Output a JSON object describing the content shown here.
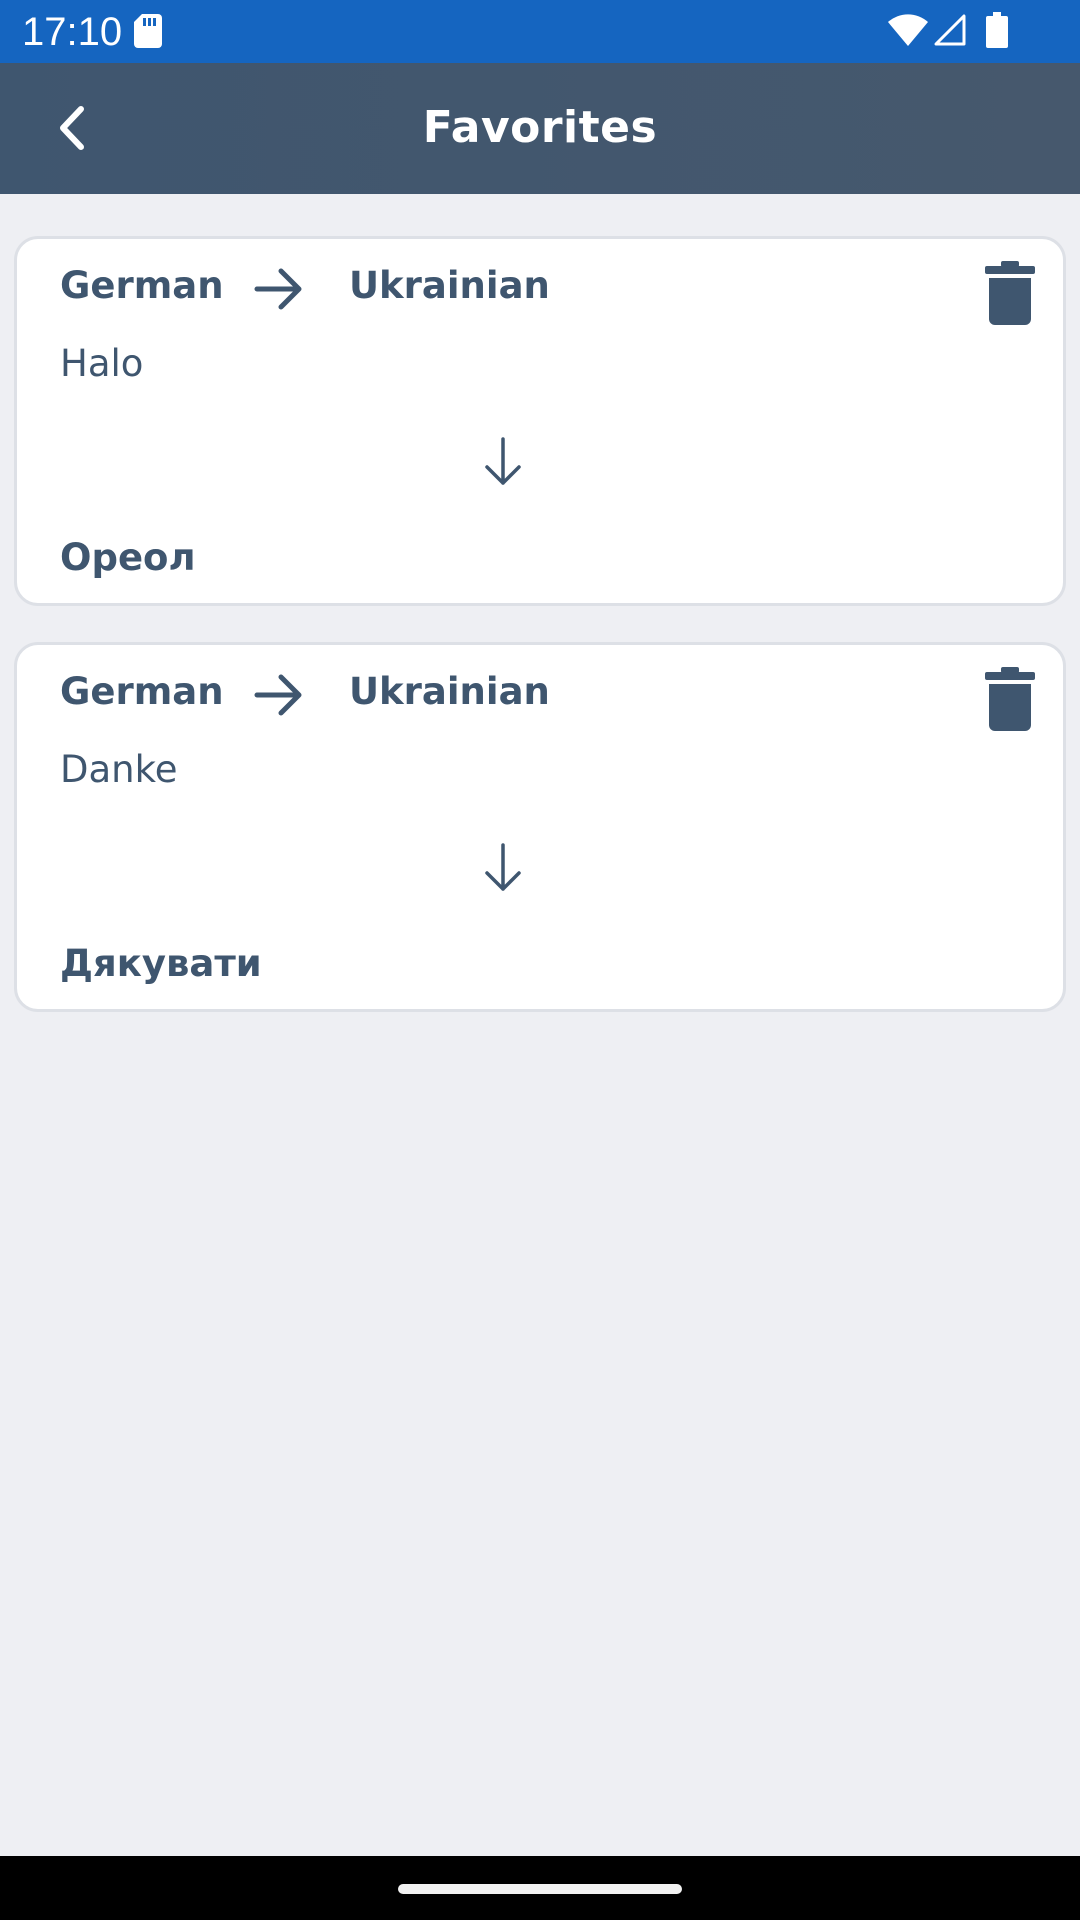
{
  "status_bar": {
    "time": "17:10",
    "icons": [
      "sd-card-icon",
      "wifi-icon",
      "signal-icon",
      "battery-icon"
    ]
  },
  "app_bar": {
    "title": "Favorites",
    "back_icon": "chevron-left-icon"
  },
  "favorites": [
    {
      "from_lang": "German",
      "to_lang": "Ukrainian",
      "source": "Halo",
      "translation": "Ореол"
    },
    {
      "from_lang": "German",
      "to_lang": "Ukrainian",
      "source": "Danke",
      "translation": "Дякувати"
    }
  ],
  "colors": {
    "status_bar": "#1565c0",
    "app_bar": "#3f566f",
    "background": "#eeeff3",
    "text": "#3f566f",
    "card": "#ffffff"
  }
}
